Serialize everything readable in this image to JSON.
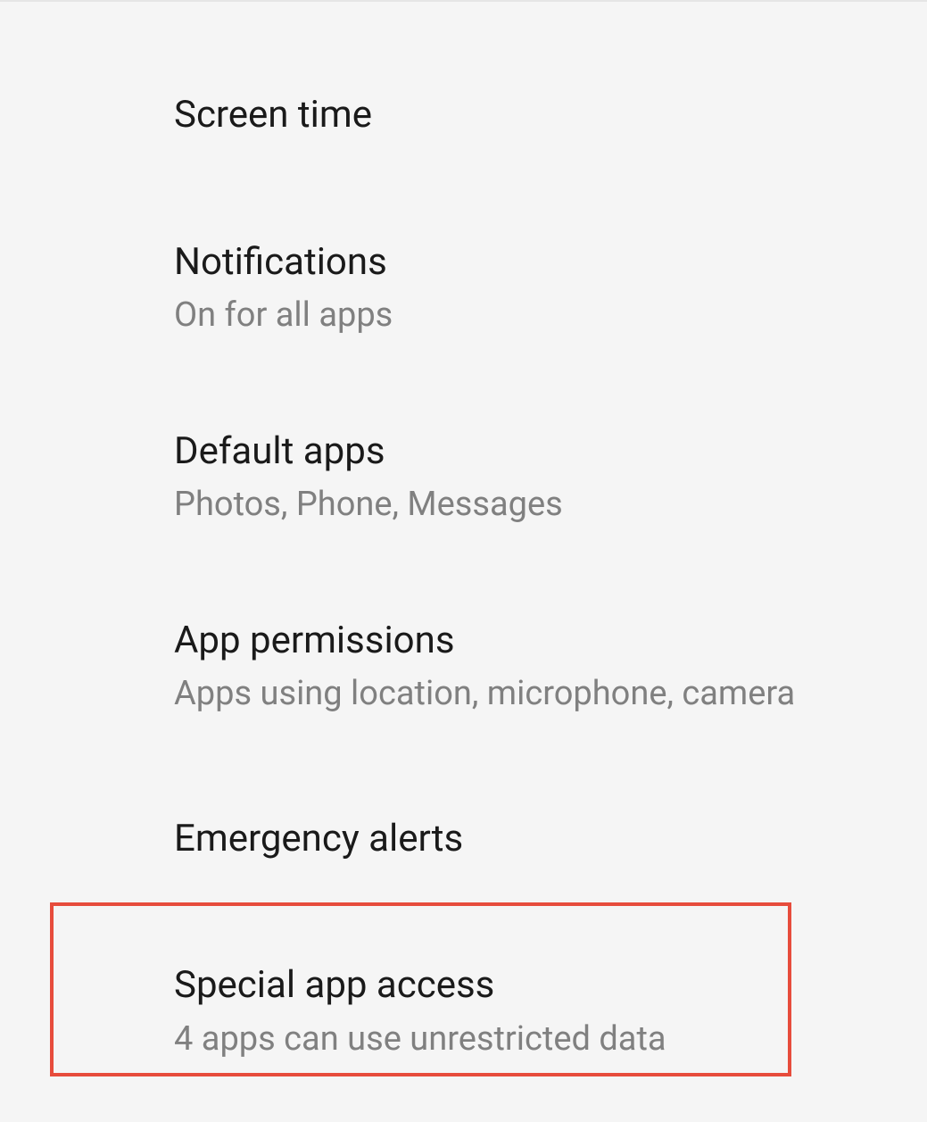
{
  "settings": {
    "items": [
      {
        "title": "Screen time",
        "subtitle": null
      },
      {
        "title": "Notifications",
        "subtitle": "On for all apps"
      },
      {
        "title": "Default apps",
        "subtitle": "Photos, Phone, Messages"
      },
      {
        "title": "App permissions",
        "subtitle": "Apps using location, microphone, camera"
      },
      {
        "title": "Emergency alerts",
        "subtitle": null
      },
      {
        "title": "Special app access",
        "subtitle": "4 apps can use unrestricted data"
      }
    ]
  }
}
